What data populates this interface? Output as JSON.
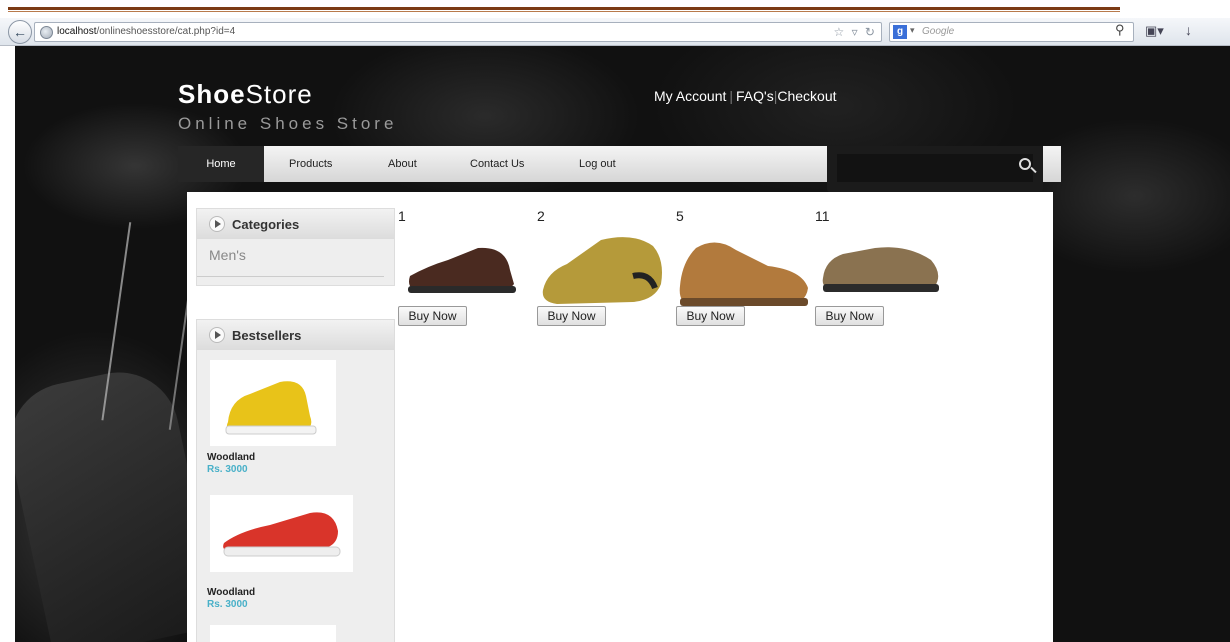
{
  "browser": {
    "url_host": "localhost",
    "url_path": "/onlineshoesstore/cat.php?id=4",
    "search_engine": "Google",
    "search_placeholder": "Google"
  },
  "header": {
    "logo_bold": "Shoe",
    "logo_light": "Store",
    "tagline": "Online Shoes Store",
    "links": [
      "My Account",
      "FAQ's",
      "Checkout"
    ]
  },
  "nav": [
    "Home",
    "Products",
    "About",
    "Contact Us",
    "Log out"
  ],
  "sidebar": {
    "categories_title": "Categories",
    "categories": [
      "Men's"
    ],
    "bestsellers_title": "Bestsellers",
    "bestsellers": [
      {
        "name": "Woodland",
        "price": "Rs. 3000",
        "color": "#e8c319"
      },
      {
        "name": "Woodland",
        "price": "Rs. 3000",
        "color": "#d9342a"
      }
    ]
  },
  "products": [
    {
      "id": "1",
      "buy_label": "Buy Now",
      "color": "#4a2a20"
    },
    {
      "id": "2",
      "buy_label": "Buy Now",
      "color": "#b59a3a"
    },
    {
      "id": "5",
      "buy_label": "Buy Now",
      "color": "#b27a3d"
    },
    {
      "id": "11",
      "buy_label": "Buy Now",
      "color": "#8a7250"
    }
  ]
}
